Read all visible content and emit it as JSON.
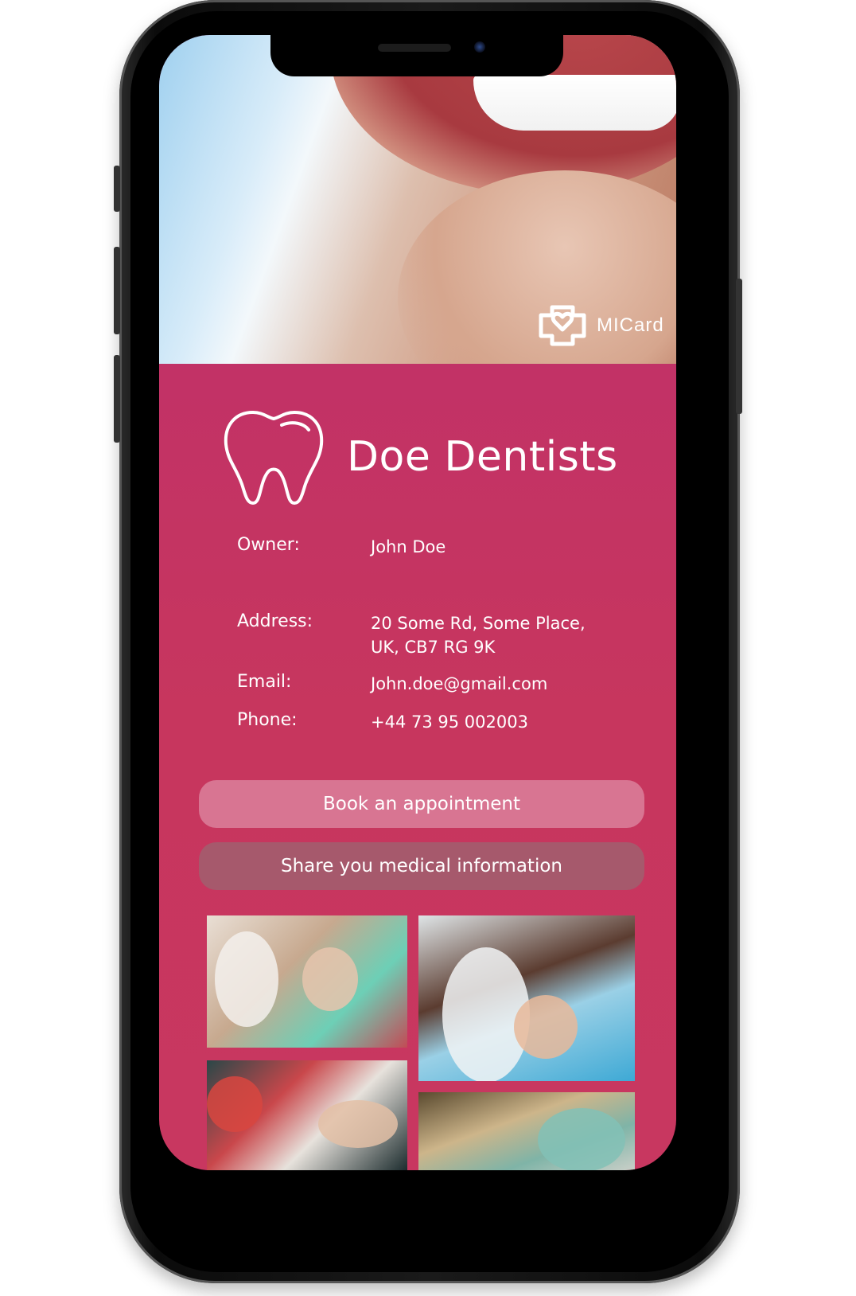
{
  "hero": {
    "brand_badge": "MICard"
  },
  "practice": {
    "name": "Doe Dentists"
  },
  "details": [
    {
      "label": "Owner:",
      "value_lines": [
        "John Doe"
      ]
    },
    {
      "label": "Address:",
      "value_lines": [
        "20 Some Rd, Some Place,",
        "UK, CB7 RG 9K"
      ]
    },
    {
      "label": "Email:",
      "value_lines": [
        "John.doe@gmail.com"
      ]
    },
    {
      "label": "Phone:",
      "value_lines": [
        "+44 73 95 002003"
      ]
    }
  ],
  "actions": {
    "book_label": "Book an appointment",
    "share_label": "Share you medical information"
  },
  "icons": {
    "brand_badge": "micard-logo-icon",
    "practice_logo": "tooth-icon"
  },
  "colors": {
    "card_top": "#a8348a",
    "card_bottom": "#c83760",
    "book_button": "#d87592",
    "share_button": "#a6596c",
    "text": "#ffffff"
  }
}
